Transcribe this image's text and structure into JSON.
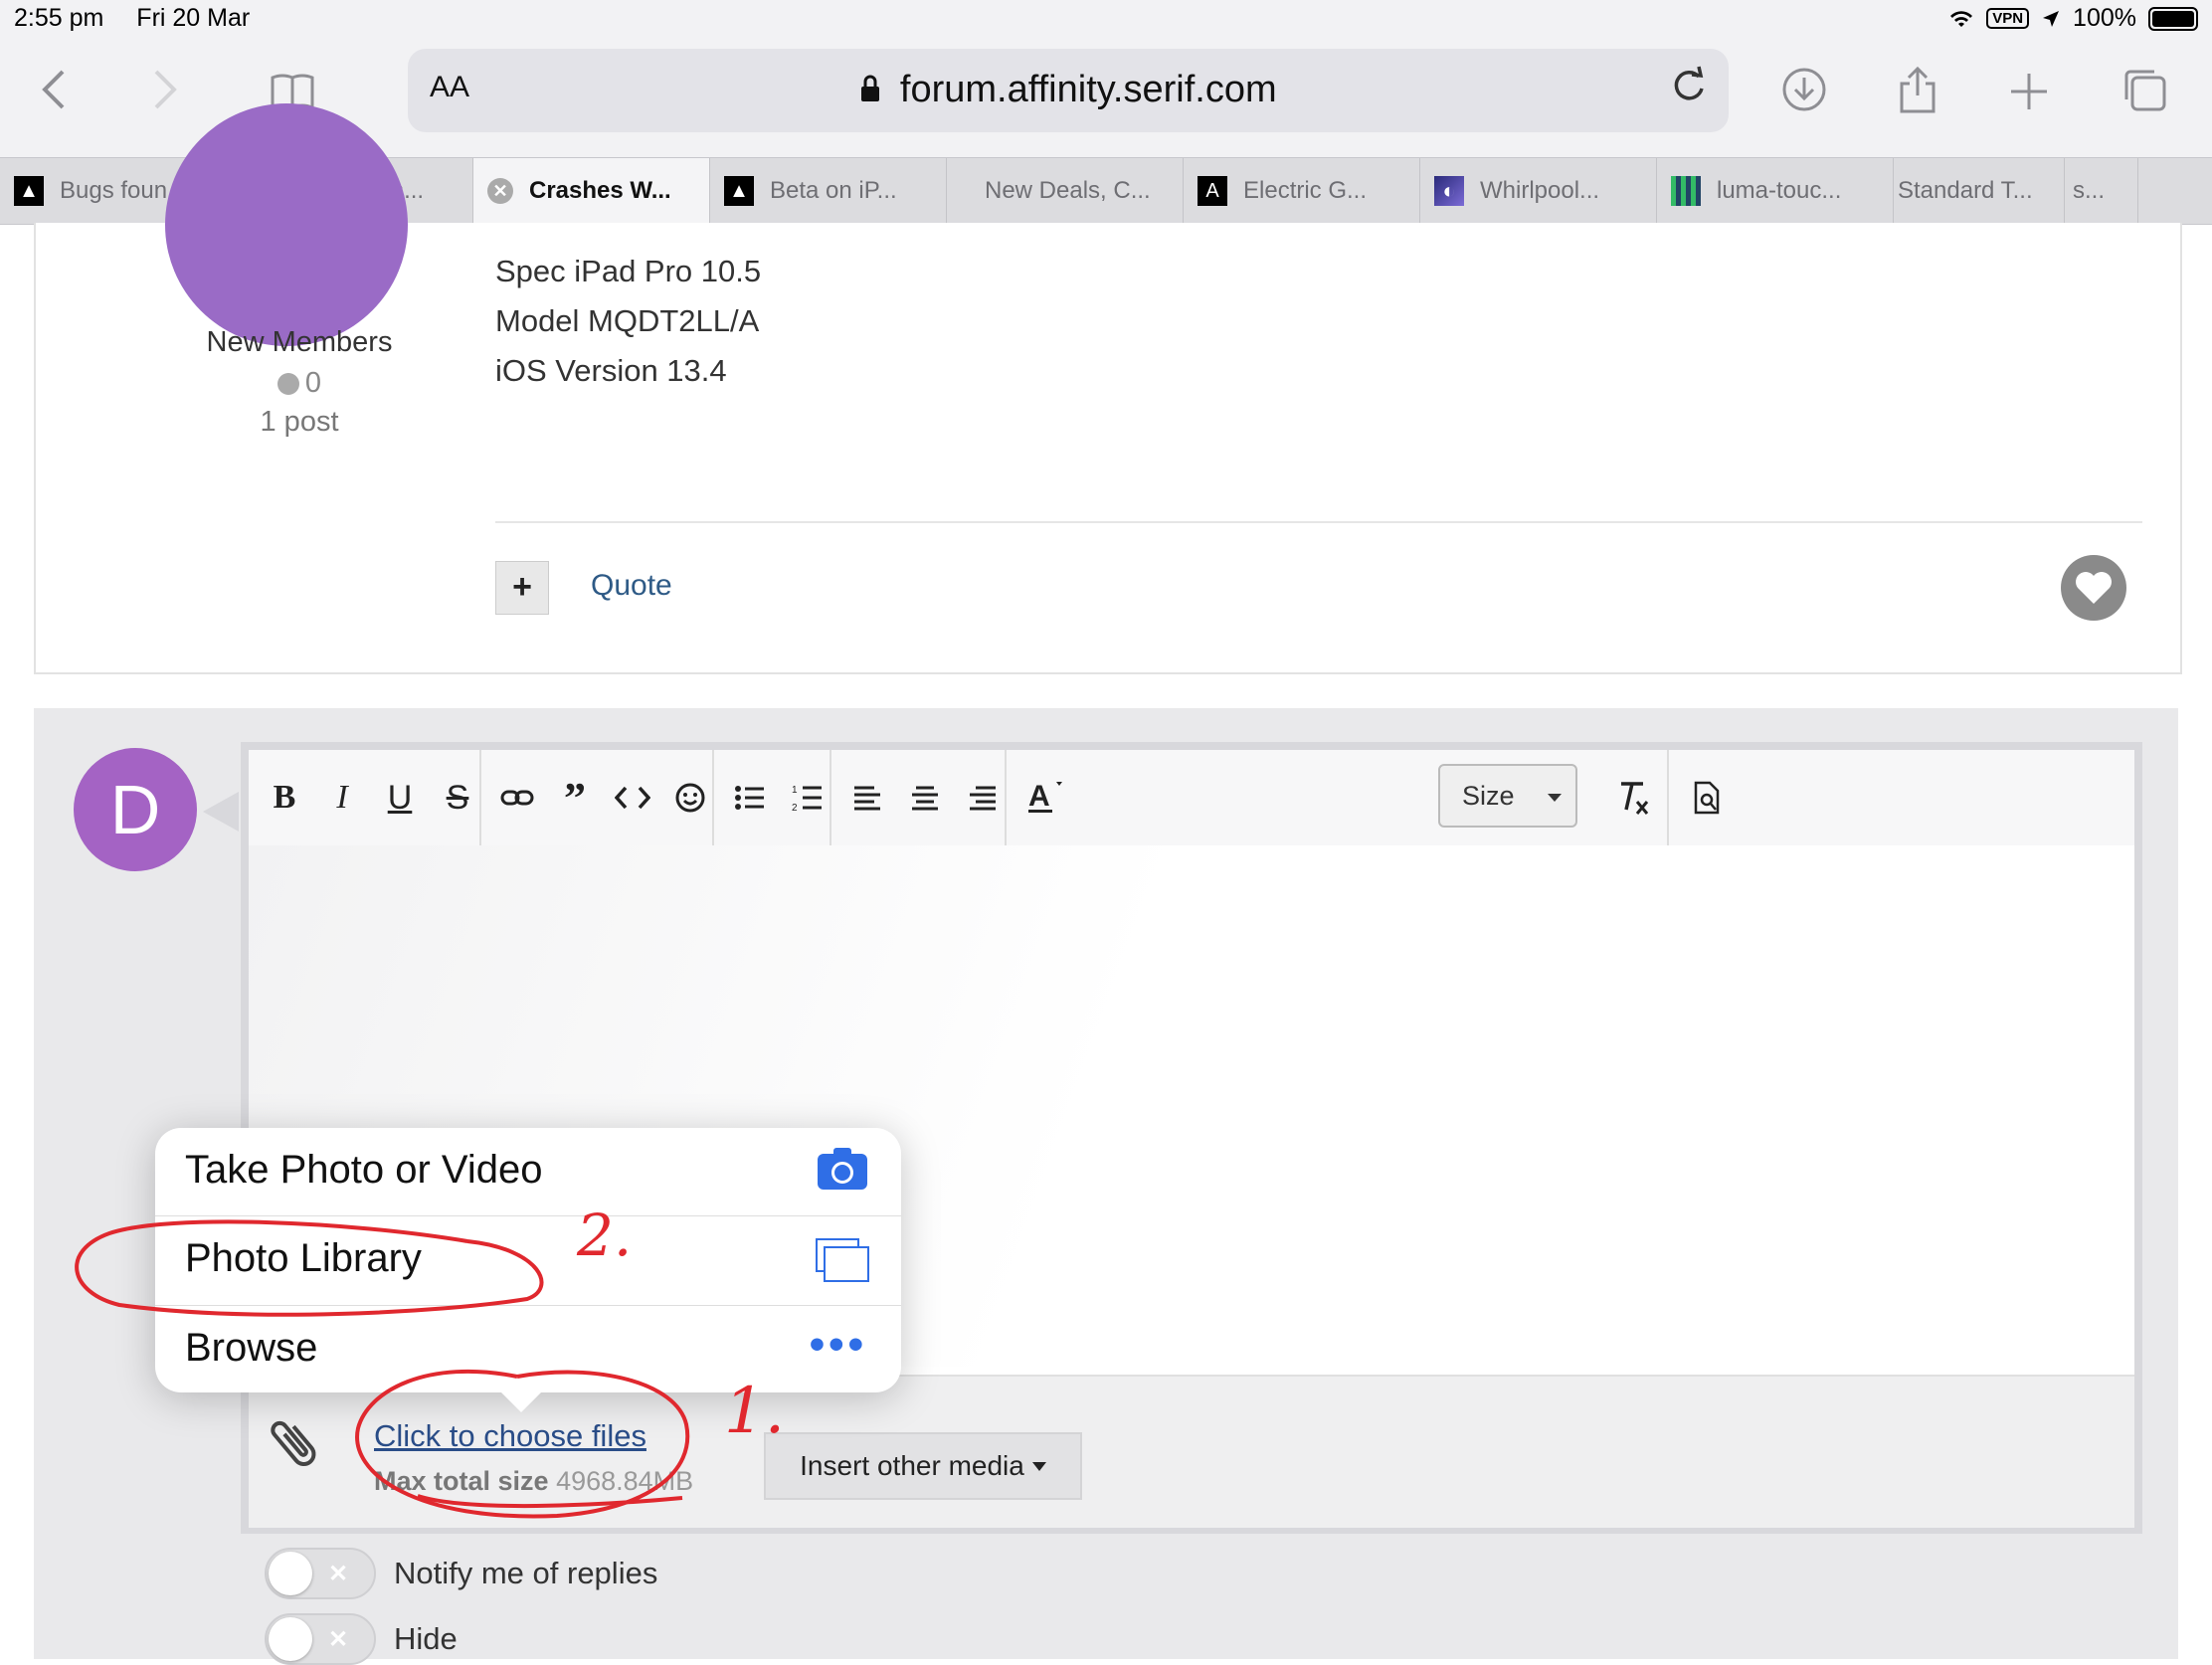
{
  "status_bar": {
    "time": "2:55 pm",
    "date": "Fri 20 Mar",
    "vpn": "VPN",
    "battery": "100%"
  },
  "browser": {
    "text_size_label": "AA",
    "url": "forum.affinity.serif.com",
    "icons": [
      "back-icon",
      "forward-icon",
      "bookmarks-icon",
      "lock-icon",
      "reload-icon",
      "download-icon",
      "share-icon",
      "new-tab-icon",
      "tabs-overview-icon"
    ]
  },
  "tabs": [
    {
      "label": "Bugs foun...",
      "icon": "affinity-icon"
    },
    {
      "label": "Bugs foun...",
      "icon": "affinity-icon"
    },
    {
      "label": "Crashes W...",
      "icon": "close-icon",
      "active": true
    },
    {
      "label": "Beta on iP...",
      "icon": "affinity-icon"
    },
    {
      "label": "New Deals, C...",
      "icon": ""
    },
    {
      "label": "Electric G...",
      "icon": "app-icon"
    },
    {
      "label": "Whirlpool...",
      "icon": "whirlpool-icon"
    },
    {
      "label": "luma-touc...",
      "icon": "grid-icon"
    },
    {
      "label": "Standard T...",
      "icon": ""
    },
    {
      "label": "s...",
      "icon": ""
    }
  ],
  "post": {
    "author_group": "New Members",
    "reputation": "0",
    "post_count": "1 post",
    "spec_lines": [
      "Spec iPad Pro 10.5",
      "Model MQDT2LL/A",
      "iOS Version 13.4"
    ],
    "quote_label": "Quote"
  },
  "reply": {
    "avatar_letter": "D",
    "size_label": "Size",
    "toolbar_icons": [
      "bold-icon",
      "italic-icon",
      "underline-icon",
      "strikethrough-icon",
      "link-icon",
      "quote-icon",
      "code-icon",
      "emoji-icon",
      "bullet-list-icon",
      "numbered-list-icon",
      "align-left-icon",
      "align-center-icon",
      "align-right-icon",
      "text-color-icon",
      "clear-format-icon",
      "preview-icon"
    ],
    "choose_files": "Click to choose files",
    "max_size_label": "Max total size",
    "max_size_value": "4968.84MB",
    "insert_media": "Insert other media",
    "notify_label": "Notify me of replies",
    "hide_label": "Hide"
  },
  "popover": {
    "items": [
      {
        "label": "Take Photo or Video",
        "icon": "camera-icon"
      },
      {
        "label": "Photo Library",
        "icon": "photo-library-icon"
      },
      {
        "label": "Browse",
        "icon": "more-icon"
      }
    ]
  },
  "annotations": {
    "step_1": "1.",
    "step_2": "2.",
    "color": "#e0282e"
  },
  "colors": {
    "link": "#2e5a86",
    "avatar_d": "#a463c4",
    "system_blue": "#2f6ee6"
  }
}
